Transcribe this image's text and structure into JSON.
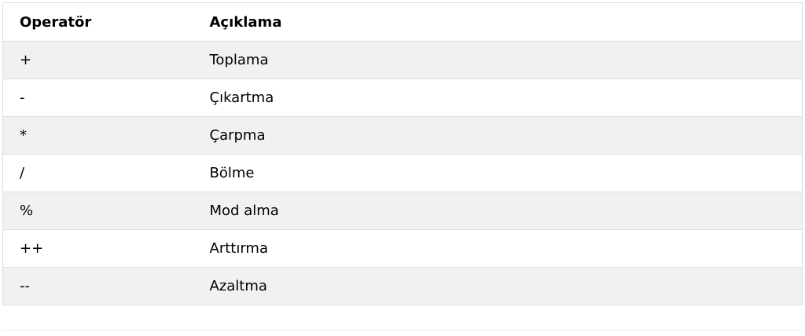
{
  "table": {
    "headers": [
      "Operatör",
      "Açıklama"
    ],
    "rows": [
      [
        "+",
        "Toplama"
      ],
      [
        "-",
        "Çıkartma"
      ],
      [
        "*",
        "Çarpma"
      ],
      [
        "/",
        "Bölme"
      ],
      [
        "%",
        "Mod alma"
      ],
      [
        "++",
        "Arttırma"
      ],
      [
        "--",
        "Azaltma"
      ]
    ]
  },
  "colors": {
    "border": "#dddddd",
    "stripe": "#f1f1f1",
    "background": "#ffffff",
    "text": "#000000"
  }
}
